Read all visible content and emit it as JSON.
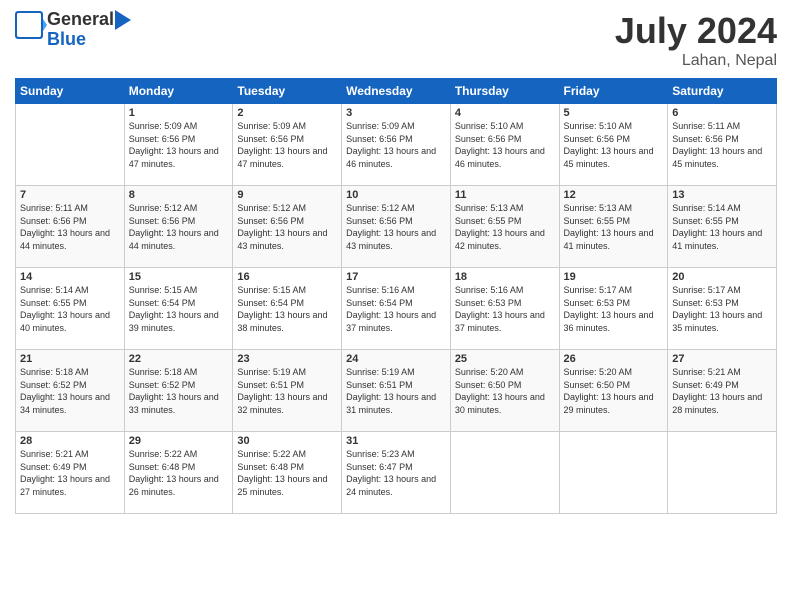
{
  "logo": {
    "general": "General",
    "blue": "Blue"
  },
  "title": "July 2024",
  "location": "Lahan, Nepal",
  "header_days": [
    "Sunday",
    "Monday",
    "Tuesday",
    "Wednesday",
    "Thursday",
    "Friday",
    "Saturday"
  ],
  "weeks": [
    [
      {
        "day": "",
        "sunrise": "",
        "sunset": "",
        "daylight": ""
      },
      {
        "day": "1",
        "sunrise": "5:09 AM",
        "sunset": "6:56 PM",
        "daylight": "13 hours and 47 minutes."
      },
      {
        "day": "2",
        "sunrise": "5:09 AM",
        "sunset": "6:56 PM",
        "daylight": "13 hours and 47 minutes."
      },
      {
        "day": "3",
        "sunrise": "5:09 AM",
        "sunset": "6:56 PM",
        "daylight": "13 hours and 46 minutes."
      },
      {
        "day": "4",
        "sunrise": "5:10 AM",
        "sunset": "6:56 PM",
        "daylight": "13 hours and 46 minutes."
      },
      {
        "day": "5",
        "sunrise": "5:10 AM",
        "sunset": "6:56 PM",
        "daylight": "13 hours and 45 minutes."
      },
      {
        "day": "6",
        "sunrise": "5:11 AM",
        "sunset": "6:56 PM",
        "daylight": "13 hours and 45 minutes."
      }
    ],
    [
      {
        "day": "7",
        "sunrise": "5:11 AM",
        "sunset": "6:56 PM",
        "daylight": "13 hours and 44 minutes."
      },
      {
        "day": "8",
        "sunrise": "5:12 AM",
        "sunset": "6:56 PM",
        "daylight": "13 hours and 44 minutes."
      },
      {
        "day": "9",
        "sunrise": "5:12 AM",
        "sunset": "6:56 PM",
        "daylight": "13 hours and 43 minutes."
      },
      {
        "day": "10",
        "sunrise": "5:12 AM",
        "sunset": "6:56 PM",
        "daylight": "13 hours and 43 minutes."
      },
      {
        "day": "11",
        "sunrise": "5:13 AM",
        "sunset": "6:55 PM",
        "daylight": "13 hours and 42 minutes."
      },
      {
        "day": "12",
        "sunrise": "5:13 AM",
        "sunset": "6:55 PM",
        "daylight": "13 hours and 41 minutes."
      },
      {
        "day": "13",
        "sunrise": "5:14 AM",
        "sunset": "6:55 PM",
        "daylight": "13 hours and 41 minutes."
      }
    ],
    [
      {
        "day": "14",
        "sunrise": "5:14 AM",
        "sunset": "6:55 PM",
        "daylight": "13 hours and 40 minutes."
      },
      {
        "day": "15",
        "sunrise": "5:15 AM",
        "sunset": "6:54 PM",
        "daylight": "13 hours and 39 minutes."
      },
      {
        "day": "16",
        "sunrise": "5:15 AM",
        "sunset": "6:54 PM",
        "daylight": "13 hours and 38 minutes."
      },
      {
        "day": "17",
        "sunrise": "5:16 AM",
        "sunset": "6:54 PM",
        "daylight": "13 hours and 37 minutes."
      },
      {
        "day": "18",
        "sunrise": "5:16 AM",
        "sunset": "6:53 PM",
        "daylight": "13 hours and 37 minutes."
      },
      {
        "day": "19",
        "sunrise": "5:17 AM",
        "sunset": "6:53 PM",
        "daylight": "13 hours and 36 minutes."
      },
      {
        "day": "20",
        "sunrise": "5:17 AM",
        "sunset": "6:53 PM",
        "daylight": "13 hours and 35 minutes."
      }
    ],
    [
      {
        "day": "21",
        "sunrise": "5:18 AM",
        "sunset": "6:52 PM",
        "daylight": "13 hours and 34 minutes."
      },
      {
        "day": "22",
        "sunrise": "5:18 AM",
        "sunset": "6:52 PM",
        "daylight": "13 hours and 33 minutes."
      },
      {
        "day": "23",
        "sunrise": "5:19 AM",
        "sunset": "6:51 PM",
        "daylight": "13 hours and 32 minutes."
      },
      {
        "day": "24",
        "sunrise": "5:19 AM",
        "sunset": "6:51 PM",
        "daylight": "13 hours and 31 minutes."
      },
      {
        "day": "25",
        "sunrise": "5:20 AM",
        "sunset": "6:50 PM",
        "daylight": "13 hours and 30 minutes."
      },
      {
        "day": "26",
        "sunrise": "5:20 AM",
        "sunset": "6:50 PM",
        "daylight": "13 hours and 29 minutes."
      },
      {
        "day": "27",
        "sunrise": "5:21 AM",
        "sunset": "6:49 PM",
        "daylight": "13 hours and 28 minutes."
      }
    ],
    [
      {
        "day": "28",
        "sunrise": "5:21 AM",
        "sunset": "6:49 PM",
        "daylight": "13 hours and 27 minutes."
      },
      {
        "day": "29",
        "sunrise": "5:22 AM",
        "sunset": "6:48 PM",
        "daylight": "13 hours and 26 minutes."
      },
      {
        "day": "30",
        "sunrise": "5:22 AM",
        "sunset": "6:48 PM",
        "daylight": "13 hours and 25 minutes."
      },
      {
        "day": "31",
        "sunrise": "5:23 AM",
        "sunset": "6:47 PM",
        "daylight": "13 hours and 24 minutes."
      },
      {
        "day": "",
        "sunrise": "",
        "sunset": "",
        "daylight": ""
      },
      {
        "day": "",
        "sunrise": "",
        "sunset": "",
        "daylight": ""
      },
      {
        "day": "",
        "sunrise": "",
        "sunset": "",
        "daylight": ""
      }
    ]
  ],
  "labels": {
    "sunrise_prefix": "Sunrise: ",
    "sunset_prefix": "Sunset: ",
    "daylight_prefix": "Daylight: "
  }
}
